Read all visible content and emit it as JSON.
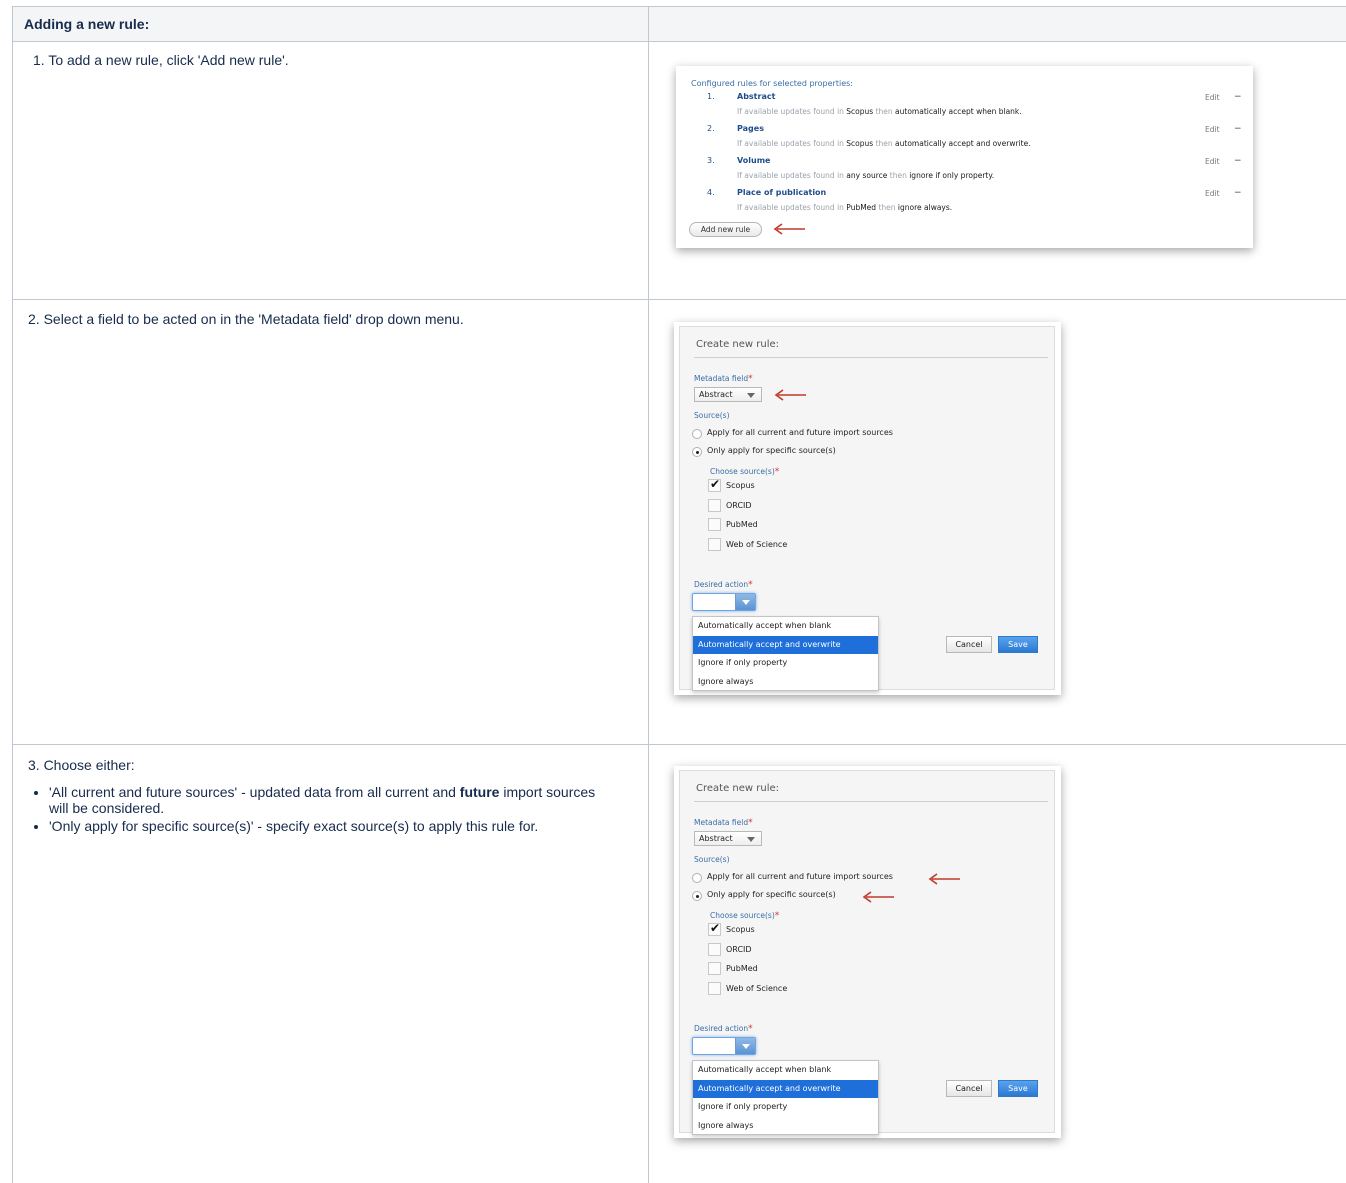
{
  "header": {
    "title": "Adding a new rule:"
  },
  "steps": {
    "step1": "1. To add a new rule, click 'Add new rule'.",
    "step2": "2. Select a field to be acted on in the 'Metadata field' drop down menu.",
    "step3": {
      "intro": "3. Choose either:",
      "bullet1_pre": "'All current and future sources' - updated data from all current and ",
      "bullet1_bold": "future",
      "bullet1_post": " import sources will be considered.",
      "bullet2": "'Only apply for specific source(s)' - specify exact source(s) to apply this rule for."
    }
  },
  "rules_panel": {
    "title": "Configured rules for selected properties:",
    "rules": [
      {
        "num": "1.",
        "name": "Abstract",
        "pre": "If available updates found in ",
        "source": "Scopus",
        "mid": " then ",
        "action": "automatically accept when blank",
        "end": "."
      },
      {
        "num": "2.",
        "name": "Pages",
        "pre": "If available updates found in ",
        "source": "Scopus",
        "mid": " then ",
        "action": "automatically accept and overwrite",
        "end": "."
      },
      {
        "num": "3.",
        "name": "Volume",
        "pre": "If available updates found in ",
        "source": "any source",
        "mid": " then ",
        "action": "ignore if only property",
        "end": "."
      },
      {
        "num": "4.",
        "name": "Place of publication",
        "pre": "If available updates found in ",
        "source": "PubMed",
        "mid": " then ",
        "action": "ignore always",
        "end": "."
      }
    ],
    "edit_label": "Edit",
    "remove_label": "−",
    "add_button": "Add new rule"
  },
  "dialog": {
    "title": "Create new rule:",
    "metadata_label": "Metadata field",
    "metadata_value": "Abstract",
    "sources_label": "Source(s)",
    "radio_all": "Apply for all current and future import sources",
    "radio_specific": "Only apply for specific source(s)",
    "choose_label": "Choose source(s)",
    "required_mark": "*",
    "sources": [
      {
        "name": "Scopus",
        "checked": true
      },
      {
        "name": "ORCID",
        "checked": false
      },
      {
        "name": "PubMed",
        "checked": false
      },
      {
        "name": "Web of Science",
        "checked": false
      }
    ],
    "action_label": "Desired action",
    "action_options": [
      "Automatically accept when blank",
      "Automatically accept and overwrite",
      "Ignore if only property",
      "Ignore always"
    ],
    "selected_option_index": 1,
    "cancel": "Cancel",
    "save": "Save"
  },
  "colors": {
    "arrow": "#c0392b",
    "selected": "#1e6fd9",
    "link": "#1f4e8c"
  }
}
